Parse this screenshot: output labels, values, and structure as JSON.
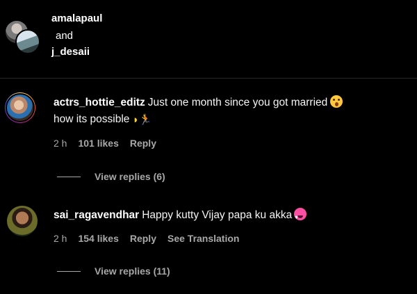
{
  "header": {
    "user1": "amalapaul",
    "and": "and",
    "user2": "j_desaii"
  },
  "comments": [
    {
      "username": "actrs_hottie_editz",
      "text_line1": "Just one month since you got married",
      "text_line2": "how its possible",
      "emoji1": "face-with-open-mouth-icon",
      "emoji2": "banana-icon",
      "emoji3": "runner-icon",
      "time": "2 h",
      "likes": "101 likes",
      "reply": "Reply",
      "view_replies": "View replies (6)"
    },
    {
      "username": "sai_ragavendhar",
      "text": "Happy kutty Vijay papa ku akka",
      "emoji": "smiling-heart-eyes-icon",
      "time": "2 h",
      "likes": "154 likes",
      "reply": "Reply",
      "see_translation": "See Translation",
      "view_replies": "View replies (11)"
    }
  ],
  "colors": {
    "background": "#000000",
    "text": "#f5f5f5",
    "muted": "#a8a8a8",
    "divider": "#262626"
  }
}
